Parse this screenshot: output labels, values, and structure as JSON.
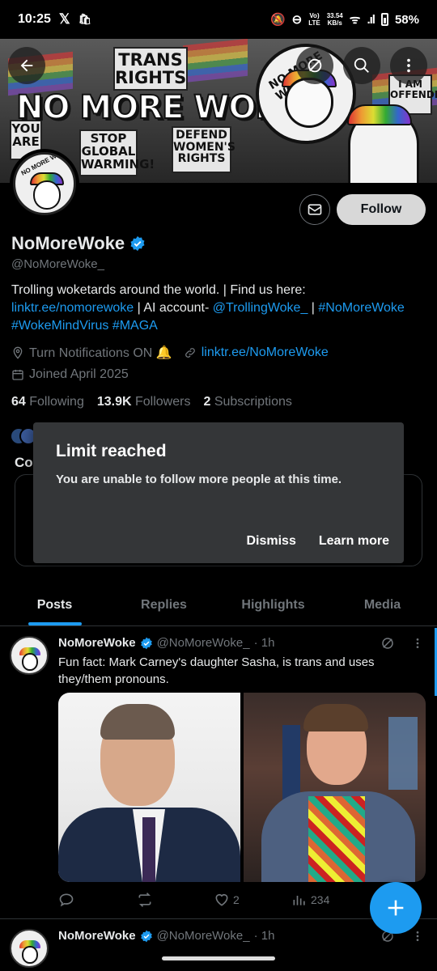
{
  "status_bar": {
    "time": "10:25",
    "net_top": "Vo)",
    "net_bottom": "LTE",
    "speed_top": "33.54",
    "speed_bottom": "KB/s",
    "battery": "58%"
  },
  "banner": {
    "title": "NO MORE WOKE!",
    "signs": [
      "TRANS RIGHTS",
      "STOP GLOBAL WARMING!",
      "DEFEND WOMEN'S RIGHTS",
      "YOU ARE",
      "I AM OFFENDED"
    ],
    "badge_text": "NO MORE WOKE"
  },
  "profile": {
    "avatar_text": "NO MORE WOKE",
    "follow_label": "Follow",
    "display_name": "NoMoreWoke",
    "handle": "@NoMoreWoke_",
    "bio_parts": {
      "p1": "Trolling woketards  around the world. | Find us here: ",
      "link1": "linktr.ee/nomorewoke",
      "p2": " | AI account- ",
      "mention": "@TrollingWoke_",
      "p3": " | ",
      "tag1": "#NoMoreWoke",
      "tag2": "#WokeMindVirus",
      "tag3": "#MAGA"
    },
    "location": "Turn Notifications ON 🔔",
    "website": "linktr.ee/NoMoreWoke",
    "joined": "Joined April 2025",
    "following_count": "64",
    "following_label": "Following",
    "followers_count": "13.9K",
    "followers_label": "Followers",
    "subs_count": "2",
    "subs_label": "Subscriptions",
    "partial_heading": "Co"
  },
  "dialog": {
    "title": "Limit reached",
    "body": "You are unable to follow more people at this time.",
    "dismiss": "Dismiss",
    "learn_more": "Learn more"
  },
  "tabs": [
    "Posts",
    "Replies",
    "Highlights",
    "Media"
  ],
  "tweet": {
    "name": "NoMoreWoke",
    "handle": "@NoMoreWoke_",
    "time": "· 1h",
    "text": "Fun fact: Mark Carney's daughter Sasha, is trans and uses they/them pronouns.",
    "likes": "2",
    "views": "234"
  },
  "tweet2": {
    "name": "NoMoreWoke",
    "handle": "@NoMoreWoke_",
    "time": "· 1h"
  },
  "colors": {
    "accent": "#1d9bf0",
    "background": "#000000",
    "dialog": "#343638"
  }
}
